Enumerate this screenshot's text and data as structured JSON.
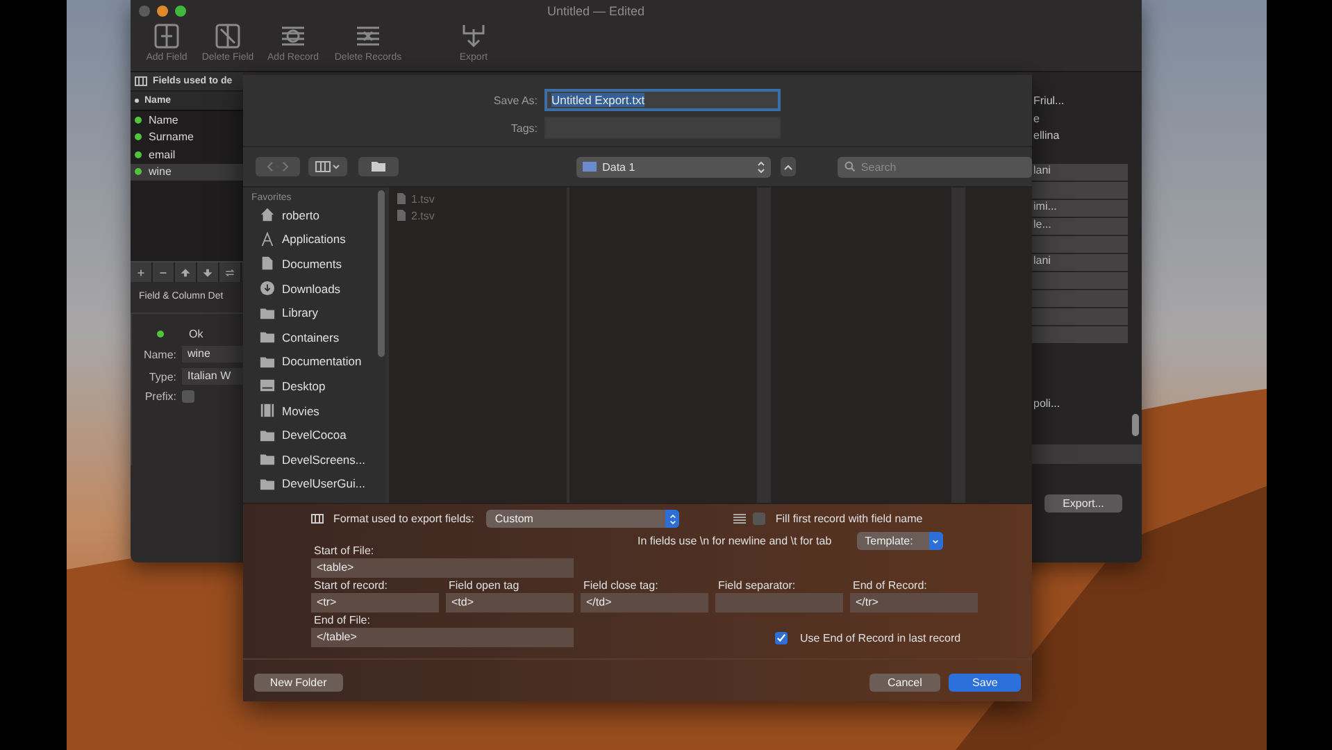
{
  "main_window": {
    "title": "Untitled — Edited",
    "toolbar": [
      {
        "label": "Add Field",
        "kind": "add-field"
      },
      {
        "label": "Delete Field",
        "kind": "delete-field"
      },
      {
        "label": "Add Record",
        "kind": "add-record"
      },
      {
        "label": "Delete Records",
        "kind": "delete-records"
      },
      {
        "label": "Export",
        "kind": "export"
      }
    ],
    "fields_panel": {
      "header": "Fields used to de",
      "column": "Name",
      "fields": [
        {
          "name": "Name",
          "selected": false
        },
        {
          "name": "Surname",
          "selected": false
        },
        {
          "name": "email",
          "selected": false
        },
        {
          "name": "wine",
          "selected": true
        }
      ]
    },
    "field_details": {
      "title": "Field & Column Det",
      "status": "Ok",
      "name_label": "Name:",
      "name_value": "wine",
      "type_label": "Type:",
      "type_value": "Italian W",
      "prefix_label": "Prefix:",
      "prefix_checked": false
    },
    "records_column": {
      "texts": [
        "Friul...",
        "e",
        "ellina"
      ],
      "cells": [
        "lani",
        "",
        "imi...",
        "le...",
        "",
        "lani",
        "",
        "",
        "",
        ""
      ],
      "footer_text": "poli..."
    },
    "export_button": "Export..."
  },
  "save_sheet": {
    "save_as_label": "Save As:",
    "save_as_value": "Untitled Export.txt",
    "tags_label": "Tags:",
    "location": "Data 1",
    "search_placeholder": "Search",
    "sidebar": {
      "heading": "Favorites",
      "items": [
        {
          "label": "roberto",
          "kind": "home"
        },
        {
          "label": "Applications",
          "kind": "apps"
        },
        {
          "label": "Documents",
          "kind": "documents"
        },
        {
          "label": "Downloads",
          "kind": "downloads"
        },
        {
          "label": "Library",
          "kind": "folder"
        },
        {
          "label": "Containers",
          "kind": "folder"
        },
        {
          "label": "Documentation",
          "kind": "folder"
        },
        {
          "label": "Desktop",
          "kind": "desktop"
        },
        {
          "label": "Movies",
          "kind": "movies"
        },
        {
          "label": "DevelCocoa",
          "kind": "folder"
        },
        {
          "label": "DevelScreens...",
          "kind": "folder"
        },
        {
          "label": "DevelUserGui...",
          "kind": "folder"
        }
      ]
    },
    "files": [
      "1.tsv",
      "2.tsv"
    ],
    "export_options": {
      "format_label": "Format used to export fields:",
      "format_value": "Custom",
      "fill_first": {
        "label": "Fill first record with field name",
        "checked": false
      },
      "hint": "In fields use \\n for newline and \\t for tab",
      "template": "Template:",
      "start_of_file": {
        "label": "Start of File:",
        "value": "<table>"
      },
      "record_fields": [
        {
          "label": "Start of record:",
          "value": "<tr>"
        },
        {
          "label": "Field open tag",
          "value": "<td>"
        },
        {
          "label": "Field close tag:",
          "value": "</td>"
        },
        {
          "label": "Field separator:"
        },
        {
          "label": "End of Record:",
          "value": "</tr>"
        }
      ],
      "end_of_file": {
        "label": "End of File:",
        "value": "</table>"
      },
      "use_end_of_record": {
        "label": "Use End of Record in last record",
        "checked": true
      }
    },
    "buttons": [
      {
        "label": "New Folder",
        "kind": "plain"
      },
      {
        "label": "Cancel",
        "kind": "plain"
      },
      {
        "label": "Save",
        "kind": "primary"
      }
    ]
  }
}
